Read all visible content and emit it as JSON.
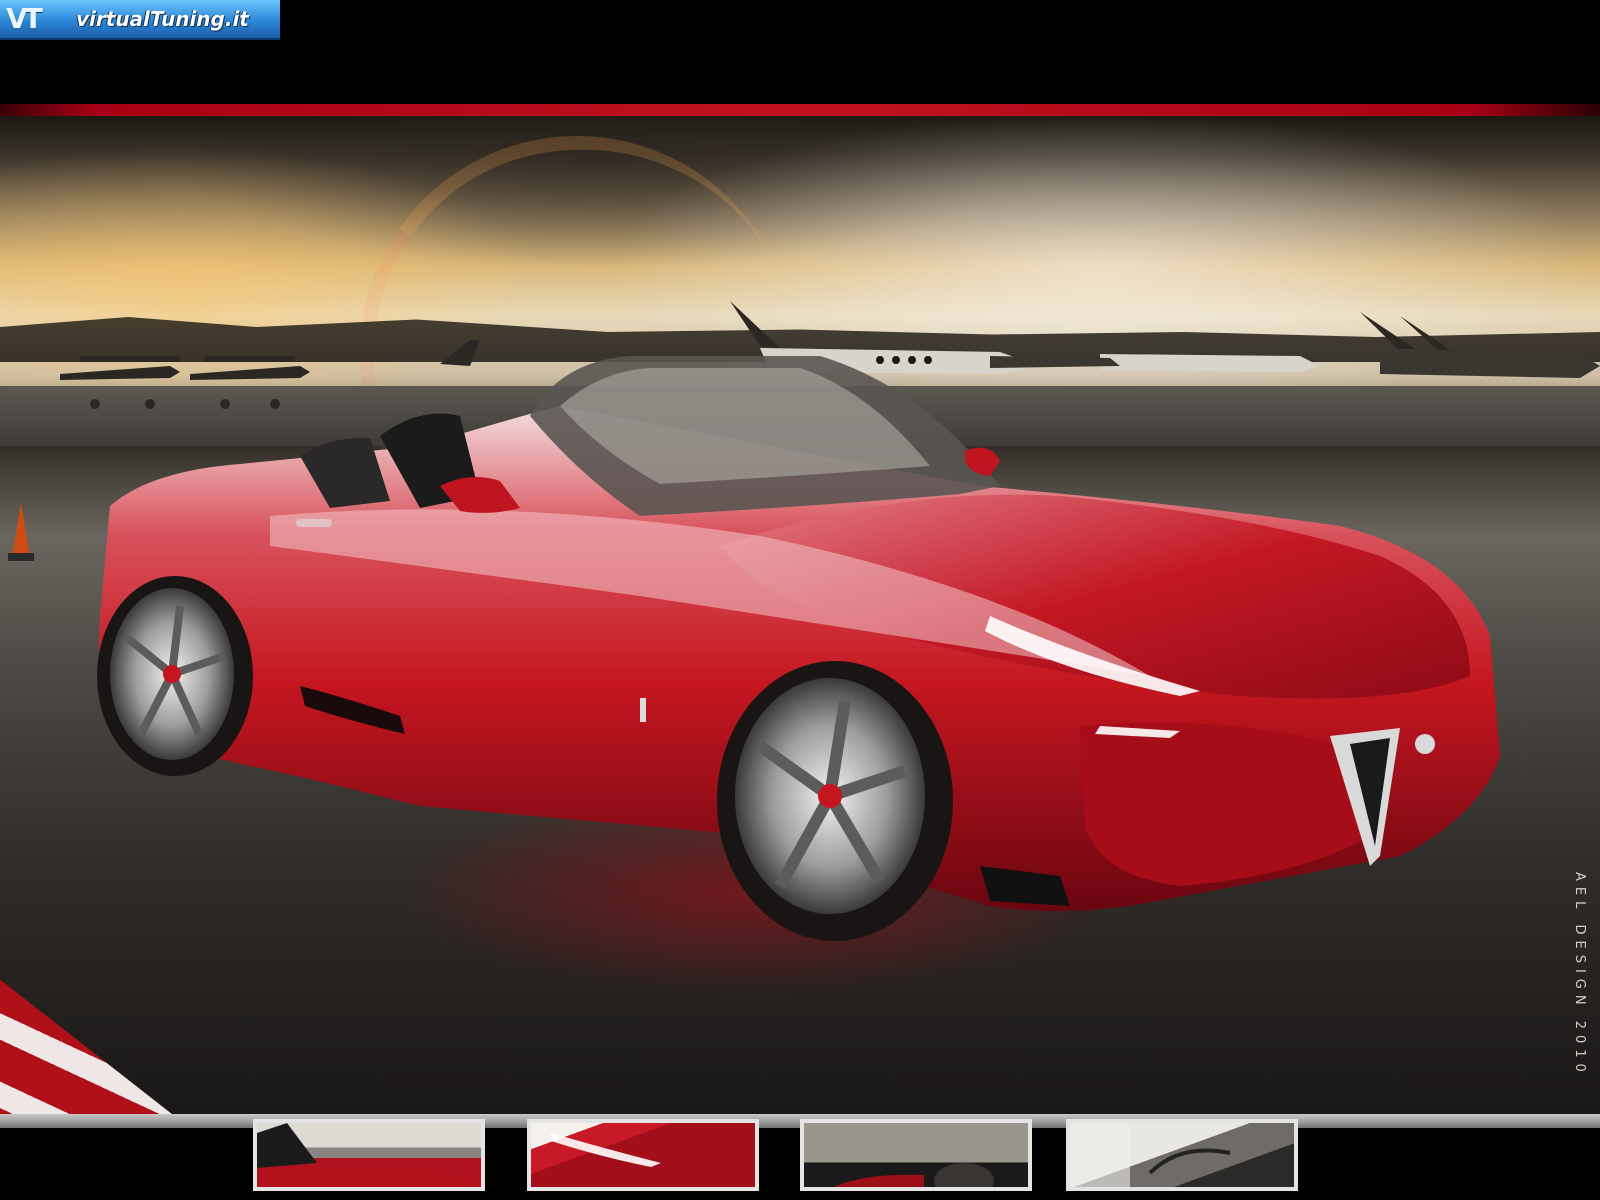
{
  "site": {
    "logo_mark": "VT",
    "logo_text": "virtualTuning.it"
  },
  "image": {
    "watermark": "AEL DESIGN 2010"
  },
  "gallery": {
    "thumbnails": [
      {
        "name": "thumb-1"
      },
      {
        "name": "thumb-2"
      },
      {
        "name": "thumb-3"
      },
      {
        "name": "thumb-4"
      }
    ]
  },
  "colors": {
    "car_red": "#c5161f",
    "strip_red": "#c2121f",
    "logo_blue": "#2a86d6"
  }
}
